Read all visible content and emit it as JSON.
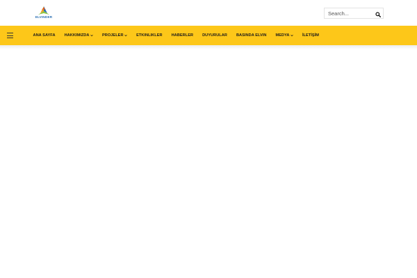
{
  "logo": {
    "text": "ELVINDER",
    "icon": "triangle-logo-icon"
  },
  "search": {
    "placeholder": "Search...",
    "icon": "search-icon"
  },
  "menu_icon": "hamburger-icon",
  "nav": {
    "items": [
      {
        "label": "ANA SAYFA",
        "has_dropdown": false
      },
      {
        "label": "HAKKIMIZDA",
        "has_dropdown": true
      },
      {
        "label": "PROJELER",
        "has_dropdown": true
      },
      {
        "label": "ETKINLIKLER",
        "has_dropdown": false
      },
      {
        "label": "HABERLER",
        "has_dropdown": false
      },
      {
        "label": "DUYURULAR",
        "has_dropdown": false
      },
      {
        "label": "BASINDA ELVIN",
        "has_dropdown": false
      },
      {
        "label": "MEDYA",
        "has_dropdown": true
      },
      {
        "label": "İLETİŞİM",
        "has_dropdown": false
      }
    ]
  },
  "colors": {
    "nav_background": "#fdc719",
    "nav_text": "#1a1a1a",
    "logo_blue": "#2a6fb3",
    "logo_orange": "#f39a1e",
    "logo_green": "#8cc63f"
  }
}
